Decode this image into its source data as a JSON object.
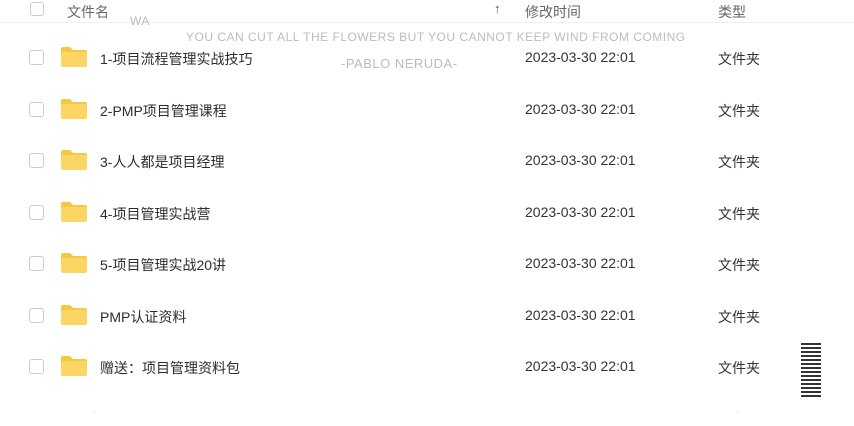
{
  "header": {
    "name_label": "文件名",
    "modified_label": "修改时间",
    "type_label": "类型",
    "sort_indicator": "↑"
  },
  "watermark": {
    "quote": "YOU CAN CUT ALL THE FLOWERS BUT YOU CANNOT KEEP WIND FROM COMING",
    "author": "-PABLO NERUDA-",
    "faint_left": "WA"
  },
  "files": [
    {
      "name": "1-项目流程管理实战技巧",
      "modified": "2023-03-30 22:01",
      "type": "文件夹"
    },
    {
      "name": "2-PMP项目管理课程",
      "modified": "2023-03-30 22:01",
      "type": "文件夹"
    },
    {
      "name": "3-人人都是项目经理",
      "modified": "2023-03-30 22:01",
      "type": "文件夹"
    },
    {
      "name": "4-项目管理实战营",
      "modified": "2023-03-30 22:01",
      "type": "文件夹"
    },
    {
      "name": "5-项目管理实战20讲",
      "modified": "2023-03-30 22:01",
      "type": "文件夹"
    },
    {
      "name": "PMP认证资料",
      "modified": "2023-03-30 22:01",
      "type": "文件夹"
    },
    {
      "name": "赠送：项目管理资料包",
      "modified": "2023-03-30 22:01",
      "type": "文件夹"
    }
  ],
  "colors": {
    "folder": "#fcd664",
    "folder_tab": "#f5c842"
  },
  "icons": {
    "folder": "folder-icon",
    "sort": "sort-ascending-icon",
    "checkbox": "checkbox-icon"
  }
}
